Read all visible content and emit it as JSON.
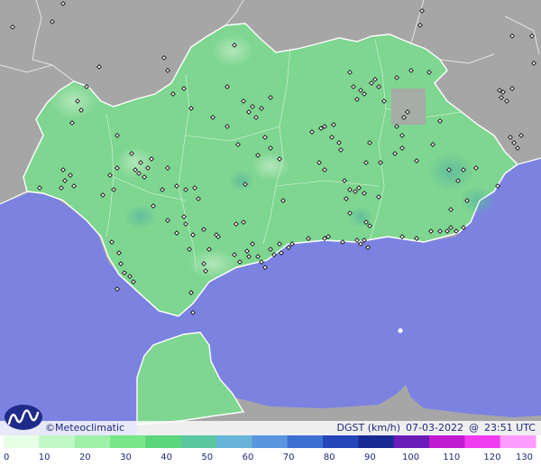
{
  "map": {
    "credit": "©Meteoclimatic",
    "variable": "DGST (km/h)",
    "date": "07-03-2022",
    "at": "@",
    "time": "23:51 UTC",
    "colors": {
      "sea": "#7b82e0",
      "land_outside": "#a6a6a6",
      "region": "#7ed690",
      "station": "#111111"
    }
  },
  "scale": {
    "ticks": [
      0,
      10,
      20,
      30,
      40,
      50,
      60,
      70,
      80,
      90,
      100,
      110,
      120,
      130
    ],
    "colors": [
      "#e6ffe6",
      "#c2f7c8",
      "#9ef0a8",
      "#7ae68a",
      "#5bd67a",
      "#5ac7a0",
      "#68b3d8",
      "#5a96e0",
      "#3d6fd2",
      "#2446b8",
      "#1a2a94",
      "#6a1cb8",
      "#c21ad0",
      "#f03cf0",
      "#ff9cff"
    ]
  }
}
